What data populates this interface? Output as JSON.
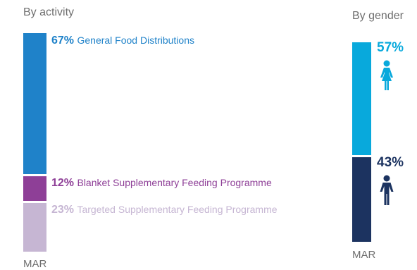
{
  "activity_chart": {
    "title": "By activity",
    "period_label": "MAR"
  },
  "gender_chart": {
    "title": "By gender",
    "period_label": "MAR",
    "icons": [
      "female-figure-icon",
      "male-figure-icon"
    ]
  },
  "chart_data": [
    {
      "type": "bar",
      "stacked": true,
      "title": "By activity",
      "categories": [
        "MAR"
      ],
      "series": [
        {
          "name": "General Food Distributions",
          "values": [
            67
          ],
          "label": "67%",
          "color": "#1f82c9"
        },
        {
          "name": "Blanket Supplementary Feeding Programme",
          "values": [
            12
          ],
          "label": "12%",
          "color": "#8e3f97"
        },
        {
          "name": "Targeted Supplementary Feeding Programme",
          "values": [
            23
          ],
          "label": "23%",
          "color": "#c6b6d3"
        }
      ],
      "unit": "%"
    },
    {
      "type": "bar",
      "stacked": true,
      "title": "By gender",
      "categories": [
        "MAR"
      ],
      "series": [
        {
          "name": "female",
          "values": [
            57
          ],
          "label": "57%",
          "color": "#08a9dc"
        },
        {
          "name": "male",
          "values": [
            43
          ],
          "label": "43%",
          "color": "#1c3360"
        }
      ],
      "unit": "%"
    }
  ]
}
